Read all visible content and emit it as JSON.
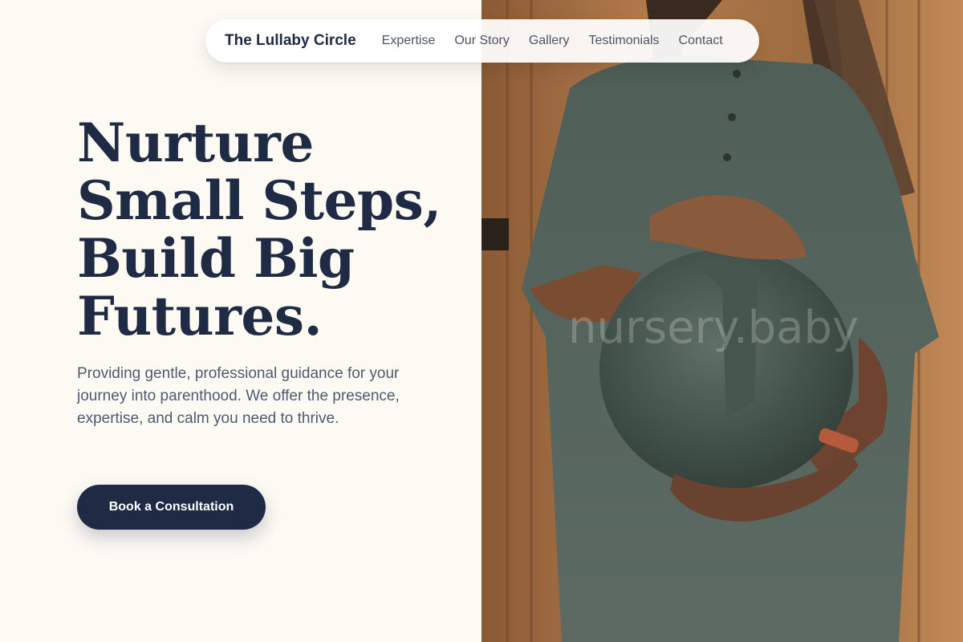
{
  "nav": {
    "brand": "The Lullaby Circle",
    "links": [
      "Expertise",
      "Our Story",
      "Gallery",
      "Testimonials",
      "Contact"
    ]
  },
  "hero": {
    "headline_lines": [
      "Nurture",
      "Small Steps,",
      "Build Big",
      "Futures."
    ],
    "subtext": "Providing gentle, professional guidance for your journey into parenthood. We offer the presence, expertise, and calm you need to thrive.",
    "cta_label": "Book a Consultation"
  },
  "photo": {
    "watermark": "nursery.baby",
    "subject": "pregnant woman in green dress against wooden door"
  },
  "colors": {
    "background": "#fdfaf4",
    "primary": "#1f2a44",
    "body_text": "#4e5a70",
    "nav_text": "#4b5566"
  }
}
